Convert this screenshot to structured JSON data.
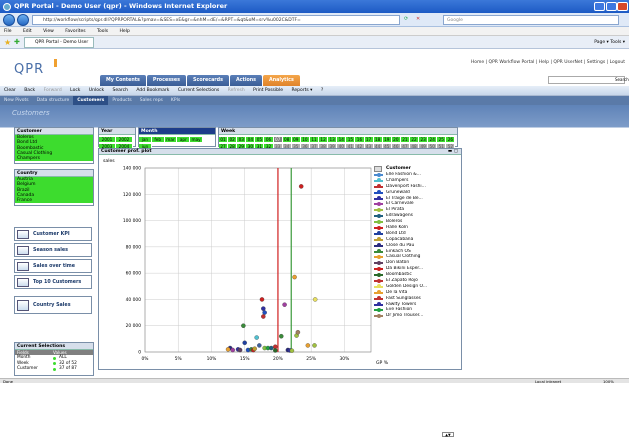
{
  "window": {
    "title": "QPR Portal - Demo User (qpr) - Windows Internet Explorer"
  },
  "address": {
    "url": "http://workflow/scripts/qpr.dll?QPRPORTAL&?pmav=&SES=xE&gr=&nhM=dE/=&RPT=&qt&oM=srv%u002C&DTF=",
    "search_placeholder": "Google"
  },
  "menu": [
    "File",
    "Edit",
    "View",
    "Favorites",
    "Tools",
    "Help"
  ],
  "favbar": {
    "tab_label": "QPR Portal - Demo User (qpr)",
    "tools": "Page ▾  Tools ▾"
  },
  "header": {
    "logo": "QPR",
    "links": "Home | QPR Workflow Portal | Help | QPR UserNet | Settings | Logout",
    "search_label": "Search",
    "tabs": [
      {
        "label": "My Contents",
        "active": false
      },
      {
        "label": "Processes",
        "active": false
      },
      {
        "label": "Scorecards",
        "active": false
      },
      {
        "label": "Actions",
        "active": false
      },
      {
        "label": "Analytics",
        "active": true
      }
    ]
  },
  "toolbar": [
    "Clear",
    "Back",
    "Forward",
    "Lock",
    "Unlock",
    "Search",
    "Add Bookmark",
    "Current Selections",
    "Refresh",
    "Print Possible",
    "Reports ▾",
    "?"
  ],
  "subtabs": [
    {
      "label": "New Pivots",
      "active": false
    },
    {
      "label": "Data structure",
      "active": false
    },
    {
      "label": "Customers",
      "active": true
    },
    {
      "label": "Products",
      "active": false
    },
    {
      "label": "Sales reps",
      "active": false
    },
    {
      "label": "KPIs",
      "active": false
    }
  ],
  "page_title": "Customers",
  "customer_list": {
    "title": "Customer",
    "items": [
      {
        "label": "Boleros",
        "state": "green"
      },
      {
        "label": "Bond Ltd",
        "state": "green"
      },
      {
        "label": "Boombastic",
        "state": "green"
      },
      {
        "label": "Casual Clothing",
        "state": "green"
      },
      {
        "label": "Champers",
        "state": "green"
      }
    ]
  },
  "country_list": {
    "title": "Country",
    "items": [
      {
        "label": "Austria",
        "state": "green"
      },
      {
        "label": "Belgium",
        "state": "green"
      },
      {
        "label": "Brazil",
        "state": "green"
      },
      {
        "label": "Canada",
        "state": "green"
      },
      {
        "label": "France",
        "state": "green"
      }
    ]
  },
  "year_list": {
    "title": "Year",
    "row1": [
      "2001",
      "2002"
    ],
    "row2": [
      "2003",
      "2004"
    ]
  },
  "month_list": {
    "title": "Month",
    "row1": [
      "jan",
      "feb",
      "mar",
      "apr",
      "may",
      "jun"
    ],
    "row2": [
      "jul",
      "aug",
      "sep",
      "oct",
      "nov",
      "dec"
    ]
  },
  "week_list": {
    "title": "Week",
    "row1": [
      "01",
      "02",
      "03",
      "04",
      "05",
      "06",
      "07",
      "08",
      "09",
      "10",
      "11",
      "12",
      "13",
      "14",
      "15",
      "16",
      "17",
      "18",
      "19",
      "20",
      "21",
      "22",
      "23",
      "24",
      "25",
      "26"
    ],
    "row2": [
      "27",
      "28",
      "29",
      "30",
      "31",
      "32",
      "33",
      "34",
      "35",
      "36",
      "37",
      "38",
      "39",
      "40",
      "41",
      "42",
      "43",
      "44",
      "45",
      "46",
      "47",
      "48",
      "49",
      "50",
      "51",
      "52"
    ]
  },
  "buttons": {
    "customer_kpi": "Customer KPI",
    "season_sales": "Season sales",
    "sales_over_time": "Sales over time",
    "top10": "Top 10 Customers",
    "country_sales": "Country Sales"
  },
  "current_selections": {
    "title": "Current Selections",
    "col1": "Fields",
    "col2": "Values",
    "rows": [
      {
        "field": "Month",
        "value": "ALL"
      },
      {
        "field": "Week",
        "value": "32 of 52"
      },
      {
        "field": "Customer",
        "value": "37 of 87"
      }
    ]
  },
  "chart_box_title": "Customer prof. plot",
  "chart_data": {
    "type": "scatter",
    "ylabel": "sales",
    "xlabel": "GP %",
    "ylim": [
      0,
      140000
    ],
    "xlim": [
      0,
      0.34
    ],
    "yticks": [
      "140 000",
      "120 000",
      "100 000",
      "80 000",
      "60 000",
      "40 000",
      "20 000",
      "0"
    ],
    "xticks": [
      "0%",
      "5%",
      "10%",
      "15%",
      "20%",
      "25%",
      "30%"
    ],
    "grid": true,
    "vlines": [
      {
        "x": 0.2,
        "color": "#d02020"
      },
      {
        "x": 0.22,
        "color": "#3a9a3a"
      }
    ],
    "points": [
      {
        "x": 0.235,
        "y": 126000,
        "color": "#cc2020"
      },
      {
        "x": 0.225,
        "y": 57000,
        "color": "#e8a030"
      },
      {
        "x": 0.256,
        "y": 40000,
        "color": "#e8e060"
      },
      {
        "x": 0.21,
        "y": 36000,
        "color": "#a040a0"
      },
      {
        "x": 0.176,
        "y": 40000,
        "color": "#cc2020"
      },
      {
        "x": 0.178,
        "y": 33000,
        "color": "#3030a0"
      },
      {
        "x": 0.18,
        "y": 30000,
        "color": "#2050c0"
      },
      {
        "x": 0.178,
        "y": 27000,
        "color": "#c03030"
      },
      {
        "x": 0.148,
        "y": 20000,
        "color": "#3a8a3a"
      },
      {
        "x": 0.205,
        "y": 12000,
        "color": "#3a8a3a"
      },
      {
        "x": 0.228,
        "y": 12500,
        "color": "#a0c040"
      },
      {
        "x": 0.23,
        "y": 15000,
        "color": "#a08060"
      },
      {
        "x": 0.245,
        "y": 5000,
        "color": "#e8a030"
      },
      {
        "x": 0.255,
        "y": 5000,
        "color": "#a0c040"
      },
      {
        "x": 0.168,
        "y": 11000,
        "color": "#50c0d0"
      },
      {
        "x": 0.15,
        "y": 7000,
        "color": "#2040a0"
      },
      {
        "x": 0.172,
        "y": 5000,
        "color": "#4060a0"
      },
      {
        "x": 0.18,
        "y": 3000,
        "color": "#80c040"
      },
      {
        "x": 0.185,
        "y": 3000,
        "color": "#20a040"
      },
      {
        "x": 0.19,
        "y": 3000,
        "color": "#206080"
      },
      {
        "x": 0.196,
        "y": 4000,
        "color": "#c03030"
      },
      {
        "x": 0.128,
        "y": 3000,
        "color": "#2a2a80"
      },
      {
        "x": 0.125,
        "y": 2000,
        "color": "#e8a030"
      },
      {
        "x": 0.132,
        "y": 1500,
        "color": "#a040a0"
      },
      {
        "x": 0.14,
        "y": 2000,
        "color": "#3030a0"
      },
      {
        "x": 0.143,
        "y": 1500,
        "color": "#604060"
      },
      {
        "x": 0.155,
        "y": 1500,
        "color": "#2050c0"
      },
      {
        "x": 0.16,
        "y": 2000,
        "color": "#3a8a3a"
      },
      {
        "x": 0.163,
        "y": 1500,
        "color": "#cc2020"
      },
      {
        "x": 0.165,
        "y": 2500,
        "color": "#c0a030"
      },
      {
        "x": 0.215,
        "y": 1500,
        "color": "#2a2a80"
      },
      {
        "x": 0.218,
        "y": 1200,
        "color": "#3030a0"
      },
      {
        "x": 0.221,
        "y": 1000,
        "color": "#a0c040"
      },
      {
        "x": 0.196,
        "y": 1200,
        "color": "#2a6a2a"
      }
    ]
  },
  "legend": {
    "title": "Customer",
    "items": [
      {
        "label": "Elle Fashion &...",
        "color": "#4a8ad0"
      },
      {
        "label": "Champers",
        "color": "#50c0d0"
      },
      {
        "label": "Davenport Fashi...",
        "color": "#c03030"
      },
      {
        "label": "Grunewald",
        "color": "#2050c0"
      },
      {
        "label": "El Traige de Be...",
        "color": "#3030a0"
      },
      {
        "label": "El Carnevale",
        "color": "#a040a0"
      },
      {
        "label": "El Pirata",
        "color": "#a0c040"
      },
      {
        "label": "Edrawagens",
        "color": "#206080"
      },
      {
        "label": "Boleros",
        "color": "#80c040"
      },
      {
        "label": "Halle Köln",
        "color": "#cc2020"
      },
      {
        "label": "Bond Ltd",
        "color": "#2040a0"
      },
      {
        "label": "Copacabana",
        "color": "#c0a030"
      },
      {
        "label": "Close du Pau",
        "color": "#2a2a80"
      },
      {
        "label": "Einkach OS",
        "color": "#3a8a3a"
      },
      {
        "label": "Casual Clothing",
        "color": "#e8a030"
      },
      {
        "label": "Don Batón",
        "color": "#604060"
      },
      {
        "label": "Da Bikini Esper...",
        "color": "#cc2020"
      },
      {
        "label": "Boombastic",
        "color": "#2a6a2a"
      },
      {
        "label": "El Zapato Rojo",
        "color": "#c03030"
      },
      {
        "label": "Golden Design O...",
        "color": "#e8e060"
      },
      {
        "label": "De la Vita",
        "color": "#e8a030"
      },
      {
        "label": "Fast Sunglasses",
        "color": "#c03030"
      },
      {
        "label": "Fawlty Towers",
        "color": "#3030a0"
      },
      {
        "label": "Eve Fashion",
        "color": "#20a040"
      },
      {
        "label": "Dr Jimo Trouser...",
        "color": "#a08060"
      }
    ]
  },
  "status": {
    "left": "Done",
    "right": "Local intranet",
    "zoom": "100%"
  }
}
